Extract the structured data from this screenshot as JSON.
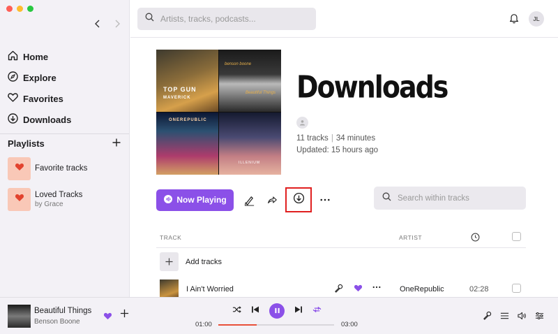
{
  "nav": {
    "home": "Home",
    "explore": "Explore",
    "favorites": "Favorites",
    "downloads": "Downloads"
  },
  "playlists": {
    "heading": "Playlists",
    "items": [
      {
        "title": "Favorite tracks",
        "subtitle": ""
      },
      {
        "title": "Loved Tracks",
        "subtitle": "by Grace"
      }
    ]
  },
  "topbar": {
    "search_placeholder": "Artists, tracks, podcasts...",
    "avatar_initials": "JL"
  },
  "page": {
    "title": "Downloads",
    "track_count": "11 tracks",
    "duration": "34 minutes",
    "updated": "Updated: 15 hours ago",
    "cover_texts": {
      "topgun": "TOP GUN",
      "topgun_sub": "MAVERICK",
      "c2_top": "benson boone",
      "c2_bottom": "Beautiful Things",
      "onerepublic": "ONEREPUBLIC",
      "c4": "ILLENIUM"
    }
  },
  "actions": {
    "now_playing": "Now Playing",
    "search_placeholder": "Search within tracks"
  },
  "table": {
    "col_track": "TRACK",
    "col_artist": "ARTIST",
    "add_tracks": "Add tracks",
    "rows": [
      {
        "title": "I Ain't Worried",
        "artist": "OneRepublic",
        "duration": "02:28"
      }
    ]
  },
  "player": {
    "title": "Beautiful Things",
    "artist": "Benson Boone",
    "elapsed": "01:00",
    "total": "03:00",
    "progress": 0.33
  },
  "colors": {
    "accent": "#8b50e8",
    "highlight": "#e02020",
    "progress": "#e8503a"
  }
}
